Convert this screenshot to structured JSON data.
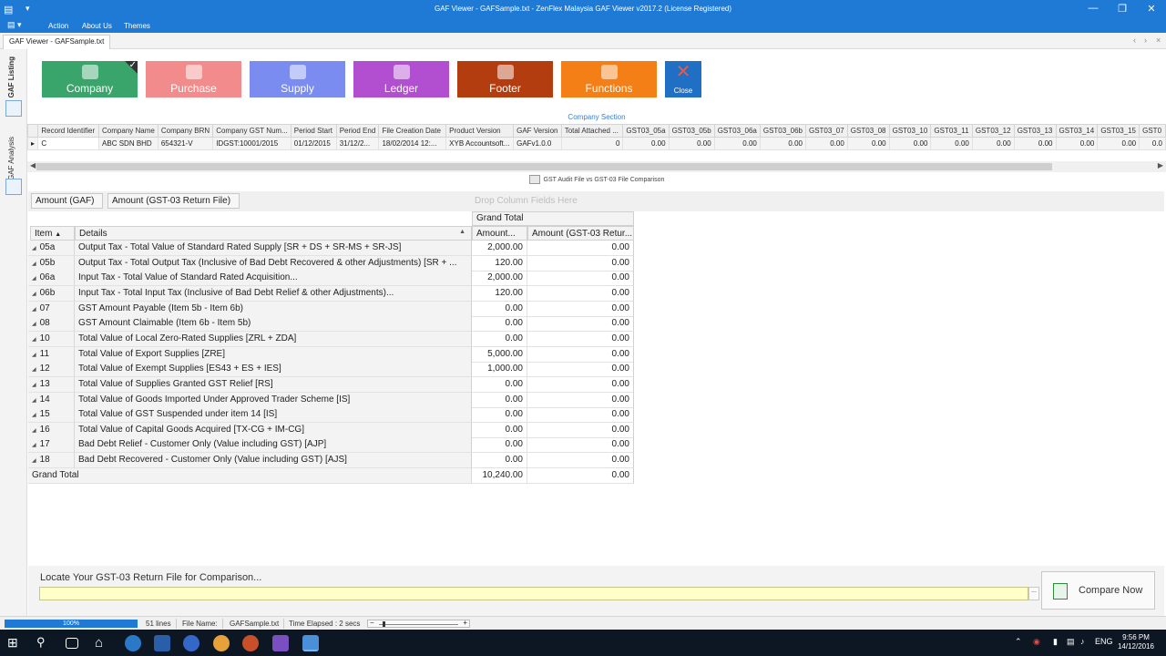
{
  "window": {
    "title": "GAF Viewer - GAFSample.txt - ZenFlex Malaysia GAF Viewer v2017.2 (License Registered)",
    "controls": [
      "—",
      "❐",
      "✕"
    ]
  },
  "ribbon_tabs": [
    "Action",
    "About Us",
    "Themes"
  ],
  "document_tab": "GAF Viewer - GAFSample.txt",
  "side_tabs": [
    "GAF Listing",
    "GAF Analysis"
  ],
  "toolbar": {
    "buttons": [
      {
        "label": "Company",
        "icon": "globe-icon",
        "color": "#3aa56b",
        "checked": true
      },
      {
        "label": "Purchase",
        "icon": "box-icon",
        "color": "#f28c8c"
      },
      {
        "label": "Supply",
        "icon": "globe-icon",
        "color": "#7b8cf0"
      },
      {
        "label": "Ledger",
        "icon": "ledger-icon",
        "color": "#b24fd0"
      },
      {
        "label": "Footer",
        "icon": "footer-icon",
        "color": "#b43d10"
      },
      {
        "label": "Functions",
        "icon": "chart-icon",
        "color": "#f47f16"
      }
    ],
    "close_label": "Close",
    "close_color": "#1f6fc5"
  },
  "company_section": {
    "title": "Company Section",
    "columns": [
      "Record Identifier",
      "Company Name",
      "Company BRN",
      "Company GST Num...",
      "Period Start",
      "Period End",
      "File Creation Date",
      "Product Version",
      "GAF Version",
      "Total Attached ...",
      "GST03_05a",
      "GST03_05b",
      "GST03_06a",
      "GST03_06b",
      "GST03_07",
      "GST03_08",
      "GST03_10",
      "GST03_11",
      "GST03_12",
      "GST03_13",
      "GST03_14",
      "GST03_15",
      "GST0"
    ],
    "row": [
      "C",
      "ABC SDN BHD",
      "654321-V",
      "IDGST:10001/2015",
      "01/12/2015",
      "31/12/2...",
      "18/02/2014 12:...",
      "XYB Accountsoft...",
      "GAFv1.0.0",
      "0",
      "0.00",
      "0.00",
      "0.00",
      "0.00",
      "0.00",
      "0.00",
      "0.00",
      "0.00",
      "0.00",
      "0.00",
      "0.00",
      "0.00",
      "0.0"
    ]
  },
  "comparison": {
    "title": "GST Audit File vs GST-03 File Comparison",
    "filter_fields": [
      "Amount (GAF)",
      "Amount (GST-03 Return File)"
    ],
    "drop_hint": "Drop Column Fields Here",
    "grand_total_header": "Grand Total",
    "row_headers": [
      "Item",
      "Details"
    ],
    "data_headers": [
      "Amount...",
      "Amount (GST-03 Retur..."
    ],
    "rows": [
      {
        "item": "05a",
        "details": "Output Tax - Total Value of Standard Rated Supply [SR + DS + SR-MS + SR-JS]",
        "gaf": "2,000.00",
        "gst03": "0.00"
      },
      {
        "item": "05b",
        "details": "Output Tax - Total Output Tax (Inclusive of Bad Debt Recovered & other Adjustments) [SR + ...",
        "gaf": "120.00",
        "gst03": "0.00"
      },
      {
        "item": "06a",
        "details": "Input Tax - Total Value of Standard Rated Acquisition...",
        "gaf": "2,000.00",
        "gst03": "0.00"
      },
      {
        "item": "06b",
        "details": "Input Tax - Total Input Tax (Inclusive of Bad Debt Relief & other Adjustments)...",
        "gaf": "120.00",
        "gst03": "0.00"
      },
      {
        "item": "07",
        "details": "GST Amount Payable (Item 5b - Item 6b)",
        "gaf": "0.00",
        "gst03": "0.00"
      },
      {
        "item": "08",
        "details": "GST Amount Claimable  (Item 6b - Item 5b)",
        "gaf": "0.00",
        "gst03": "0.00"
      },
      {
        "item": "10",
        "details": "Total Value of Local Zero-Rated Supplies [ZRL + ZDA]",
        "gaf": "0.00",
        "gst03": "0.00"
      },
      {
        "item": "11",
        "details": "Total Value of Export Supplies [ZRE]",
        "gaf": "5,000.00",
        "gst03": "0.00"
      },
      {
        "item": "12",
        "details": "Total Value of Exempt Supplies [ES43 + ES + IES]",
        "gaf": "1,000.00",
        "gst03": "0.00"
      },
      {
        "item": "13",
        "details": "Total Value of Supplies Granted GST Relief [RS]",
        "gaf": "0.00",
        "gst03": "0.00"
      },
      {
        "item": "14",
        "details": "Total Value of Goods Imported Under Approved Trader Scheme [IS]",
        "gaf": "0.00",
        "gst03": "0.00"
      },
      {
        "item": "15",
        "details": "Total Value of GST Suspended  under item 14 [IS]",
        "gaf": "0.00",
        "gst03": "0.00"
      },
      {
        "item": "16",
        "details": "Total Value of Capital Goods Acquired [TX-CG + IM-CG]",
        "gaf": "0.00",
        "gst03": "0.00"
      },
      {
        "item": "17",
        "details": "Bad Debt Relief - Customer Only (Value including GST) [AJP]",
        "gaf": "0.00",
        "gst03": "0.00"
      },
      {
        "item": "18",
        "details": "Bad Debt Recovered - Customer Only (Value including GST) [AJS]",
        "gaf": "0.00",
        "gst03": "0.00"
      }
    ],
    "grand_total": {
      "label": "Grand Total",
      "gaf": "10,240.00",
      "gst03": "0.00"
    }
  },
  "locate": {
    "label": "Locate Your GST-03 Return File for Comparison...",
    "value": "",
    "browse_label": "...",
    "compare_label": "Compare Now"
  },
  "status": {
    "progress_text": "100%",
    "progress": 1.0,
    "lines": "51 lines",
    "file_name_label": "File Name:",
    "file_name": "GAFSample.txt",
    "time_elapsed": "Time Elapsed : 2 secs"
  },
  "taskbar": {
    "language": "ENG",
    "time": "9:56 PM",
    "date": "14/12/2016",
    "accent": "#0d1724"
  }
}
